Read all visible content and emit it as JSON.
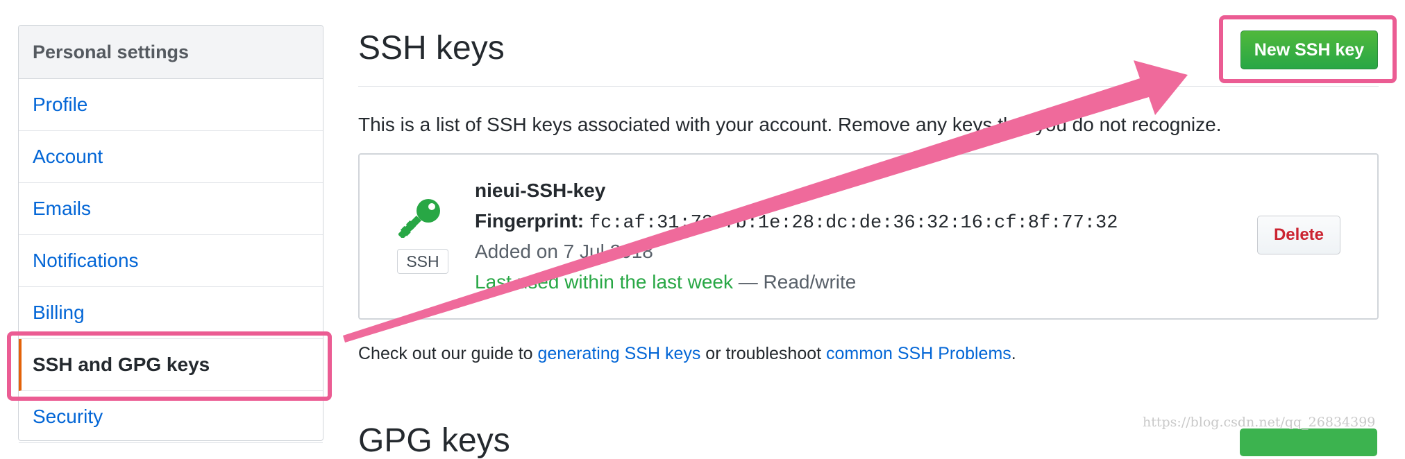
{
  "sidebar": {
    "header": "Personal settings",
    "items": [
      {
        "label": "Profile"
      },
      {
        "label": "Account"
      },
      {
        "label": "Emails"
      },
      {
        "label": "Notifications"
      },
      {
        "label": "Billing"
      },
      {
        "label": "SSH and GPG keys",
        "selected": true
      },
      {
        "label": "Security"
      }
    ]
  },
  "header": {
    "title": "SSH keys",
    "new_button": "New SSH key"
  },
  "intro": "This is a list of SSH keys associated with your account. Remove any keys that you do not recognize.",
  "key": {
    "name": "nieui-SSH-key",
    "fingerprint_label": "Fingerprint:",
    "fingerprint": "fc:af:31:73:7b:1e:28:dc:de:36:32:16:cf:8f:77:32",
    "added": "Added on 7 Jul 2018",
    "last_used": "Last used within the last week",
    "access": " — Read/write",
    "type_label": "SSH",
    "icon": "key-icon",
    "delete_button": "Delete"
  },
  "guide": {
    "prefix": "Check out our guide to ",
    "link1": "generating SSH keys",
    "middle": " or troubleshoot ",
    "link2": "common SSH Problems",
    "suffix": "."
  },
  "next_section_title": "GPG keys",
  "watermark": "https://blog.csdn.net/qq_26834399",
  "colors": {
    "annotation": "#eb5c93",
    "link": "#0366d6",
    "green": "#28a745",
    "danger": "#cb2431"
  }
}
